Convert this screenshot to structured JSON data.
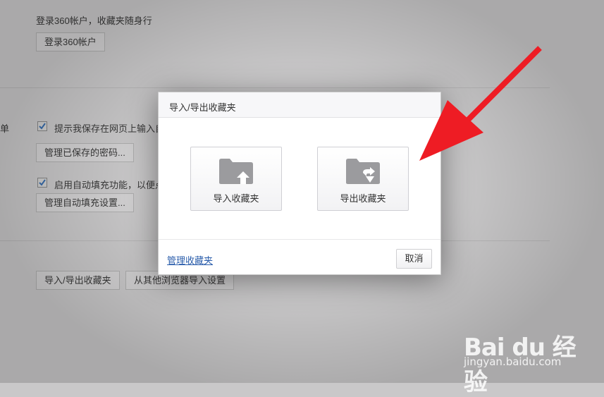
{
  "background": {
    "account_text": "登录360帐户，收藏夹随身行",
    "login_button": "登录360帐户",
    "section_label_fragment": "单",
    "save_password_text": "提示我保存在网页上输入自",
    "manage_passwords_button": "管理已保存的密码...",
    "autofill_text": "启用自动填充功能，以便点",
    "manage_autofill_button": "管理自动填充设置...",
    "import_export_button": "导入/导出收藏夹",
    "import_other_button": "从其他浏览器导入设置"
  },
  "dialog": {
    "title": "导入/导出收藏夹",
    "import_label": "导入收藏夹",
    "export_label": "导出收藏夹",
    "manage_link": "管理收藏夹",
    "cancel_label": "取消"
  },
  "watermark": {
    "brand": "Bai du 经验",
    "url": "jingyan.baidu.com"
  },
  "colors": {
    "arrow": "#ee1c24",
    "link": "#2a5dab"
  },
  "icons": {
    "import": "folder-upload-icon",
    "export": "folder-download-icon"
  }
}
